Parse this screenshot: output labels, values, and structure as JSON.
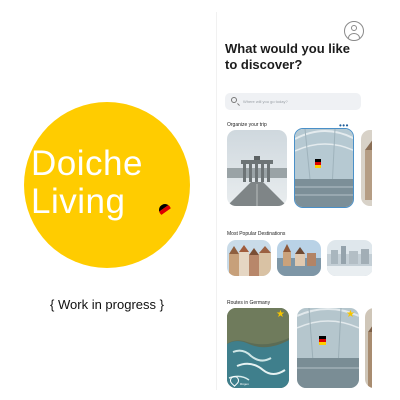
{
  "logo": {
    "line1": "Doiche",
    "line2": "Living",
    "circle_color": "#FFCC00",
    "flag_colors": [
      "#000000",
      "#DD0000",
      "#FFCE00"
    ]
  },
  "caption": "{ Work in progress }",
  "app": {
    "profile_icon": "user-circle-icon",
    "headline": "What would you like to discover?",
    "search": {
      "placeholder": "Where will you go today?",
      "icon": "search-icon"
    },
    "sections": {
      "organize": {
        "title": "Organize your trip",
        "more_icon": "more-dots-icon"
      },
      "popular": {
        "title": "Most Popular Destinations"
      },
      "routes": {
        "title": "Routes in Germany"
      }
    },
    "routes_cards": [
      {
        "starred": true,
        "place": "Rügen"
      },
      {
        "starred": true,
        "place": ""
      }
    ],
    "accent_color": "#4a90c8",
    "star_color": "#f6c500"
  }
}
